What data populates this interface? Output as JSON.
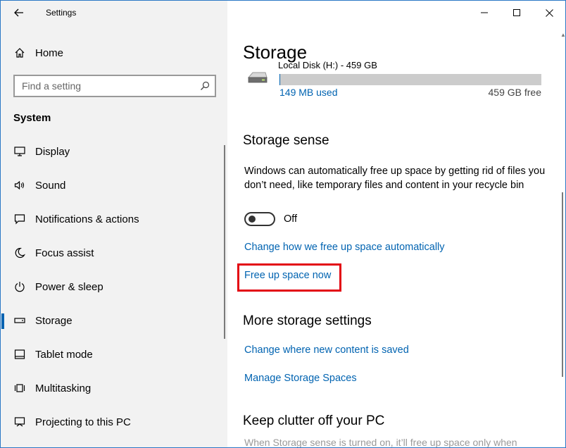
{
  "window": {
    "title": "Settings"
  },
  "sidebar": {
    "home": "Home",
    "search_placeholder": "Find a setting",
    "group": "System",
    "items": [
      {
        "label": "Display",
        "icon": "monitor-icon"
      },
      {
        "label": "Sound",
        "icon": "speaker-icon"
      },
      {
        "label": "Notifications & actions",
        "icon": "notification-icon"
      },
      {
        "label": "Focus assist",
        "icon": "moon-icon"
      },
      {
        "label": "Power & sleep",
        "icon": "power-icon"
      },
      {
        "label": "Storage",
        "icon": "storage-icon",
        "selected": true
      },
      {
        "label": "Tablet mode",
        "icon": "tablet-icon"
      },
      {
        "label": "Multitasking",
        "icon": "multitasking-icon"
      },
      {
        "label": "Projecting to this PC",
        "icon": "projecting-icon"
      }
    ]
  },
  "main": {
    "title": "Storage",
    "drive": {
      "label_cut": "Local Disk (H:) - 459 GB",
      "used": "149 MB used",
      "free": "459 GB free",
      "used_fraction": 0.0003
    },
    "storage_sense": {
      "heading": "Storage sense",
      "description": "Windows can automatically free up space by getting rid of files you don’t need, like temporary files and content in your recycle bin",
      "toggle_state": "Off",
      "link_change": "Change how we free up space automatically",
      "link_free_now": "Free up space now"
    },
    "more": {
      "heading": "More storage settings",
      "link_new_content": "Change where new content is saved",
      "link_spaces": "Manage Storage Spaces"
    },
    "clutter": {
      "heading": "Keep clutter off your PC",
      "text_cut": "When Storage sense is turned on, it’ll free up space only when"
    }
  },
  "colors": {
    "accent": "#0063b1",
    "highlight": "#e30613",
    "sidebar_bg": "#f2f2f2"
  }
}
